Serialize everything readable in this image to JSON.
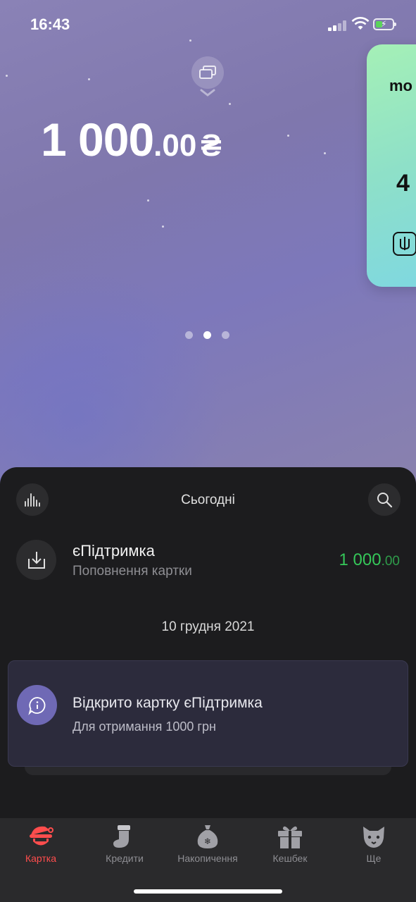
{
  "status_bar": {
    "time": "16:43"
  },
  "balance": {
    "integer": "1 000",
    "decimal": ".00",
    "currency": "₴"
  },
  "card_peek": {
    "brand": "mo",
    "number_fragment": "4"
  },
  "pager": {
    "count": 3,
    "active_index": 1
  },
  "feed": {
    "title": "Сьогодні",
    "transaction": {
      "name": "єПідтримка",
      "description": "Поповнення картки",
      "amount_integer": "1 000",
      "amount_decimal": ".00",
      "amount_color": "#35c759"
    },
    "date_header": "10 грудня 2021",
    "notice": {
      "title": "Відкрито картку єПідтримка",
      "subtitle": "Для отримання 1000 грн"
    }
  },
  "tabs": [
    {
      "label": "Картка",
      "icon": "santa-icon",
      "active": true
    },
    {
      "label": "Кредити",
      "icon": "stocking-icon",
      "active": false
    },
    {
      "label": "Накопичення",
      "icon": "money-bag-icon",
      "active": false
    },
    {
      "label": "Кешбек",
      "icon": "gift-icon",
      "active": false
    },
    {
      "label": "Ще",
      "icon": "cat-icon",
      "active": false
    }
  ],
  "colors": {
    "accent_active_tab": "#ff4d4d",
    "positive_amount": "#35c759",
    "notice_icon": "#6f69b5"
  }
}
